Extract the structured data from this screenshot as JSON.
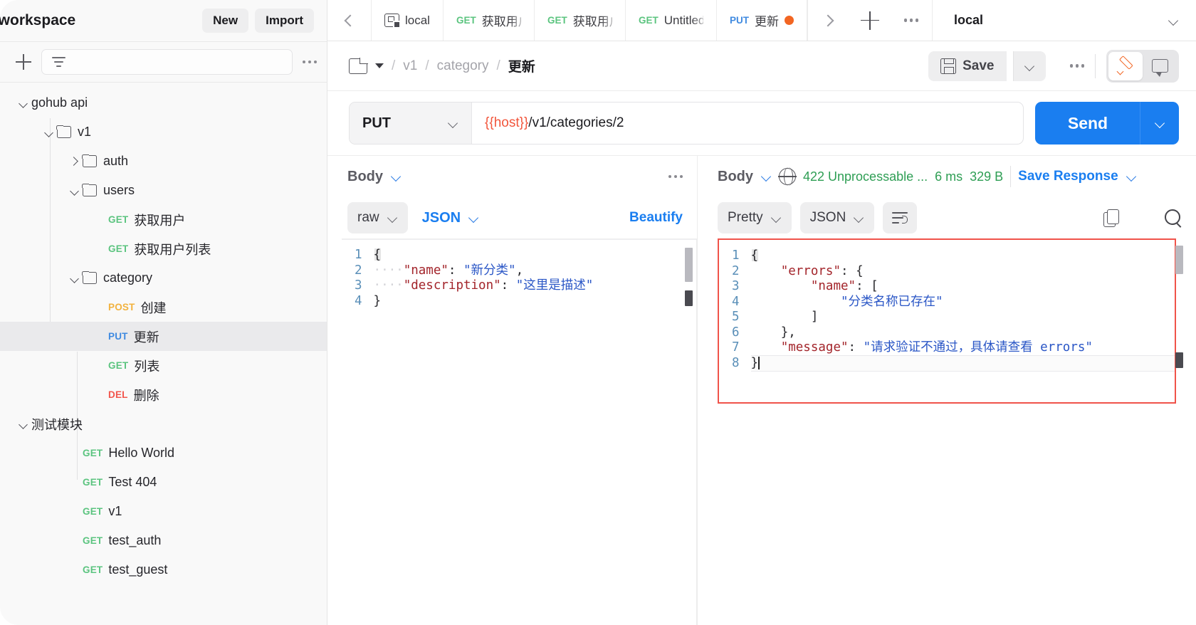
{
  "sidebar": {
    "workspace_title": "i workspace",
    "new_label": "New",
    "import_label": "Import",
    "filter_placeholder": "",
    "tree": [
      {
        "depth": 0,
        "chev": "down",
        "folder": false,
        "method": "",
        "label": "gohub api"
      },
      {
        "depth": 1,
        "chev": "down",
        "folder": true,
        "method": "",
        "label": "v1"
      },
      {
        "depth": 2,
        "chev": "right",
        "folder": true,
        "method": "",
        "label": "auth"
      },
      {
        "depth": 2,
        "chev": "down",
        "folder": true,
        "method": "",
        "label": "users"
      },
      {
        "depth": 3,
        "chev": "none",
        "folder": false,
        "method": "GET",
        "label": "获取用户"
      },
      {
        "depth": 3,
        "chev": "none",
        "folder": false,
        "method": "GET",
        "label": "获取用户列表"
      },
      {
        "depth": 2,
        "chev": "down",
        "folder": true,
        "method": "",
        "label": "category"
      },
      {
        "depth": 3,
        "chev": "none",
        "folder": false,
        "method": "POST",
        "label": "创建"
      },
      {
        "depth": 3,
        "chev": "none",
        "folder": false,
        "method": "PUT",
        "label": "更新",
        "selected": true
      },
      {
        "depth": 3,
        "chev": "none",
        "folder": false,
        "method": "GET",
        "label": "列表"
      },
      {
        "depth": 3,
        "chev": "none",
        "folder": false,
        "method": "DEL",
        "label": "删除"
      },
      {
        "depth": 0,
        "chev": "down",
        "folder": false,
        "method": "",
        "label": "测试模块"
      },
      {
        "depth": 2,
        "chev": "none",
        "folder": false,
        "method": "GET",
        "label": "Hello World"
      },
      {
        "depth": 2,
        "chev": "none",
        "folder": false,
        "method": "GET",
        "label": "Test 404"
      },
      {
        "depth": 2,
        "chev": "none",
        "folder": false,
        "method": "GET",
        "label": "v1"
      },
      {
        "depth": 2,
        "chev": "none",
        "folder": false,
        "method": "GET",
        "label": "test_auth"
      },
      {
        "depth": 2,
        "chev": "none",
        "folder": false,
        "method": "GET",
        "label": "test_guest"
      }
    ]
  },
  "tabbar": {
    "tabs": [
      {
        "kind": "env",
        "method": "",
        "label": "local",
        "dirty": false
      },
      {
        "kind": "request",
        "method": "GET",
        "label": "获取用户",
        "dirty": false
      },
      {
        "kind": "request",
        "method": "GET",
        "label": "获取用户列表",
        "dirty": false
      },
      {
        "kind": "request",
        "method": "GET",
        "label": "Untitled",
        "dirty": false
      },
      {
        "kind": "request",
        "method": "PUT",
        "label": "更新",
        "dirty": true,
        "active": true
      }
    ],
    "environment": "local"
  },
  "breadcrumb": {
    "segments": [
      "v1",
      "category"
    ],
    "current": "更新",
    "separator": "/"
  },
  "toolbar": {
    "save_label": "Save"
  },
  "request": {
    "method": "PUT",
    "url_variable": "{{host}}",
    "url_path": "/v1/categories/2",
    "send_label": "Send",
    "body_tab": "Body",
    "body_type": "raw",
    "body_format": "JSON",
    "beautify_label": "Beautify",
    "body_lines": [
      {
        "no": "1",
        "indent": 0,
        "text": "{"
      },
      {
        "no": "2",
        "indent": 1,
        "key": "\"name\"",
        "value": "\"新分类\"",
        "comma": ","
      },
      {
        "no": "3",
        "indent": 1,
        "key": "\"description\"",
        "value": "\"这里是描述\"",
        "comma": ""
      },
      {
        "no": "4",
        "indent": 0,
        "text": "}"
      }
    ]
  },
  "response": {
    "body_tab": "Body",
    "status": "422 Unprocessable ...",
    "time": "6 ms",
    "size": "329 B",
    "save_response_label": "Save Response",
    "view_mode": "Pretty",
    "format": "JSON",
    "body_lines": [
      {
        "no": "1",
        "indent": 0,
        "text": "{"
      },
      {
        "no": "2",
        "indent": 1,
        "key": "\"errors\"",
        "value": "{",
        "comma": ""
      },
      {
        "no": "3",
        "indent": 2,
        "key": "\"name\"",
        "value": "[",
        "comma": ""
      },
      {
        "no": "4",
        "indent": 3,
        "str": "\"分类名称已存在\""
      },
      {
        "no": "5",
        "indent": 2,
        "text": "]"
      },
      {
        "no": "6",
        "indent": 1,
        "text": "},"
      },
      {
        "no": "7",
        "indent": 1,
        "key": "\"message\"",
        "value": "\"请求验证不通过，具体请查看 errors\"",
        "comma": ""
      },
      {
        "no": "8",
        "indent": 0,
        "text": "}",
        "cursor": true
      }
    ]
  },
  "colors": {
    "accent_blue": "#1a7ef0",
    "accent_orange": "#f26522",
    "get_green": "#5bc47f",
    "post_orange": "#f2b23e",
    "put_blue": "#3f8ae0",
    "del_red": "#f2564d",
    "status_green": "#2e9e54",
    "error_border": "#f0534a",
    "json_key": "#a3252b",
    "json_string": "#2a56c6"
  }
}
